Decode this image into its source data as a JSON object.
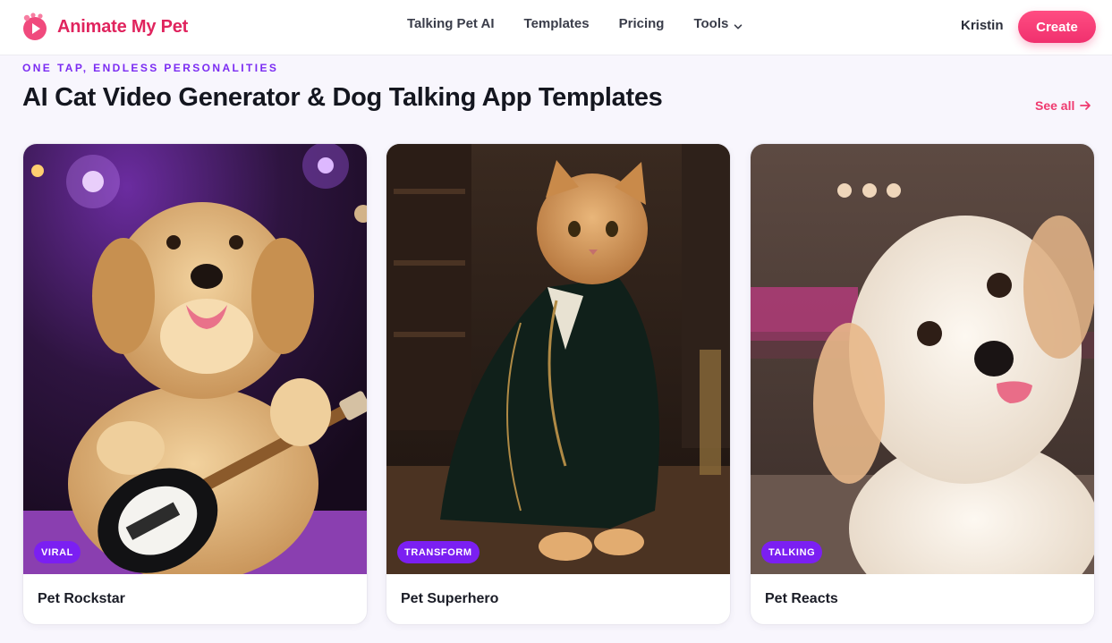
{
  "header": {
    "brand": "Animate My Pet",
    "nav": [
      {
        "label": "Talking Pet AI"
      },
      {
        "label": "Templates"
      },
      {
        "label": "Pricing"
      },
      {
        "label": "Tools"
      }
    ],
    "user": "Kristin",
    "create_label": "Create"
  },
  "section": {
    "eyebrow": "ONE TAP, ENDLESS PERSONALITIES",
    "title": "AI Cat Video Generator & Dog Talking App Templates",
    "see_all": "See all"
  },
  "cards": [
    {
      "badge": "VIRAL",
      "title": "Pet Rockstar",
      "image": "puppy-playing-guitar"
    },
    {
      "badge": "TRANSFORM",
      "title": "Pet Superhero",
      "image": "cat-in-velvet-coat"
    },
    {
      "badge": "TALKING",
      "title": "Pet Reacts",
      "image": "white-dog-head-tilt"
    }
  ],
  "colors": {
    "brand": "#e0245e",
    "accent_purple": "#7b1ff2",
    "create_button": "#f0306e"
  }
}
